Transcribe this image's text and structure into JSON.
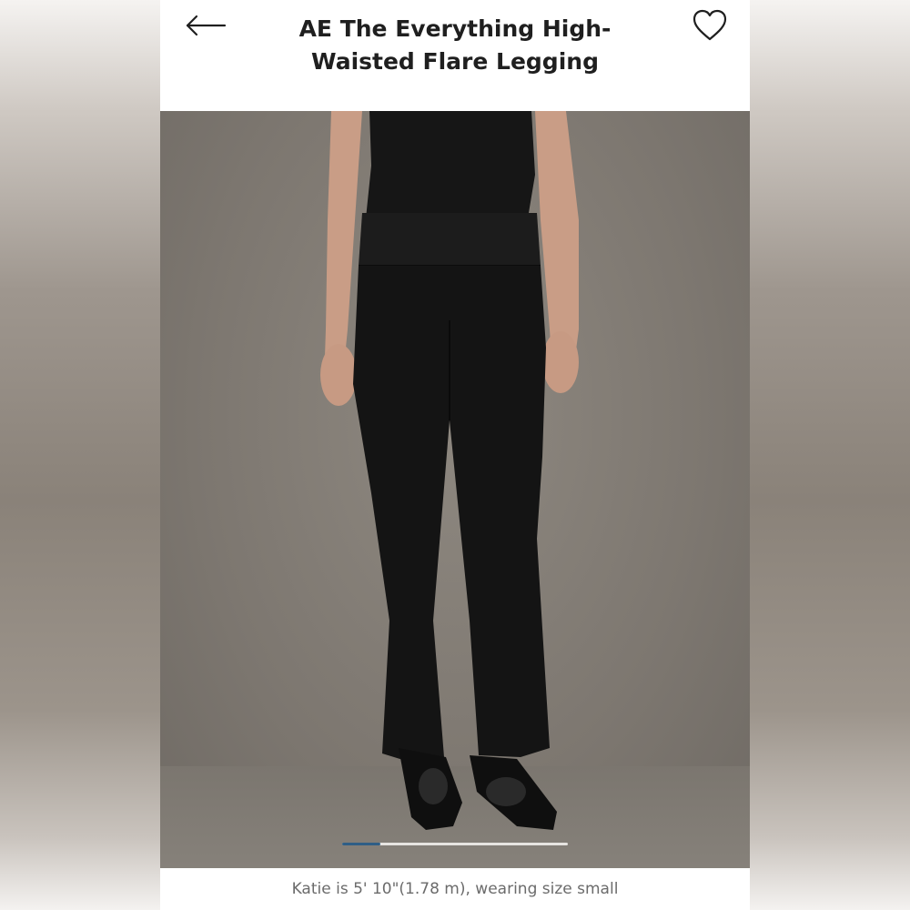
{
  "header": {
    "title": "AE The Everything High-Waisted Flare Legging",
    "back_icon": "arrow-left-icon",
    "favorite_icon": "heart-outline-icon"
  },
  "gallery": {
    "image_subject": "model-wearing-flare-leggings",
    "progress": 0.17,
    "accent_color": "#2f5e86"
  },
  "caption": {
    "text": "Katie is 5' 10\"(1.78 m), wearing size small"
  }
}
